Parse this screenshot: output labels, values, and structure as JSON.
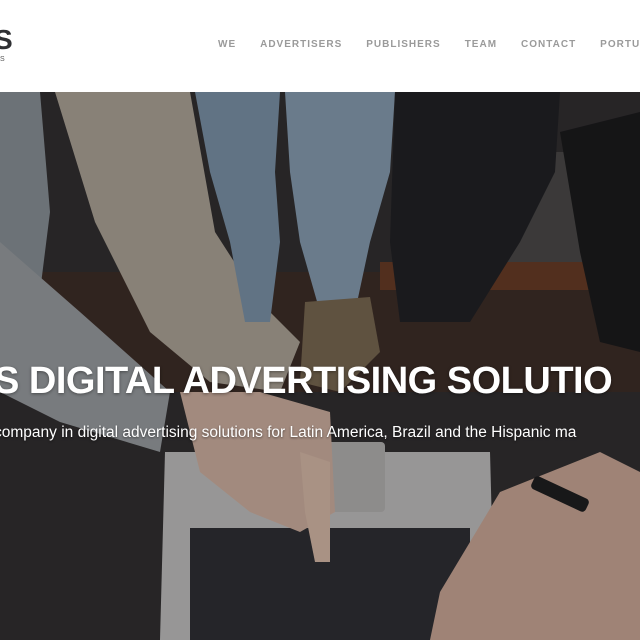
{
  "logo": {
    "main": "S",
    "sub": "NS"
  },
  "nav": [
    {
      "label": "WE"
    },
    {
      "label": "ADVERTISERS"
    },
    {
      "label": "PUBLISHERS"
    },
    {
      "label": "TEAM"
    },
    {
      "label": "CONTACT"
    },
    {
      "label": "PORTUGU"
    }
  ],
  "hero": {
    "title": "S DIGITAL ADVERTISING SOLUTIO",
    "subtitle": "company in digital advertising solutions for Latin America, Brazil and the Hispanic ma"
  },
  "colors": {
    "header_bg": "#ffffff",
    "nav_text": "#9a9a9a",
    "hero_text": "#ffffff",
    "logo_text": "#2f3033"
  }
}
